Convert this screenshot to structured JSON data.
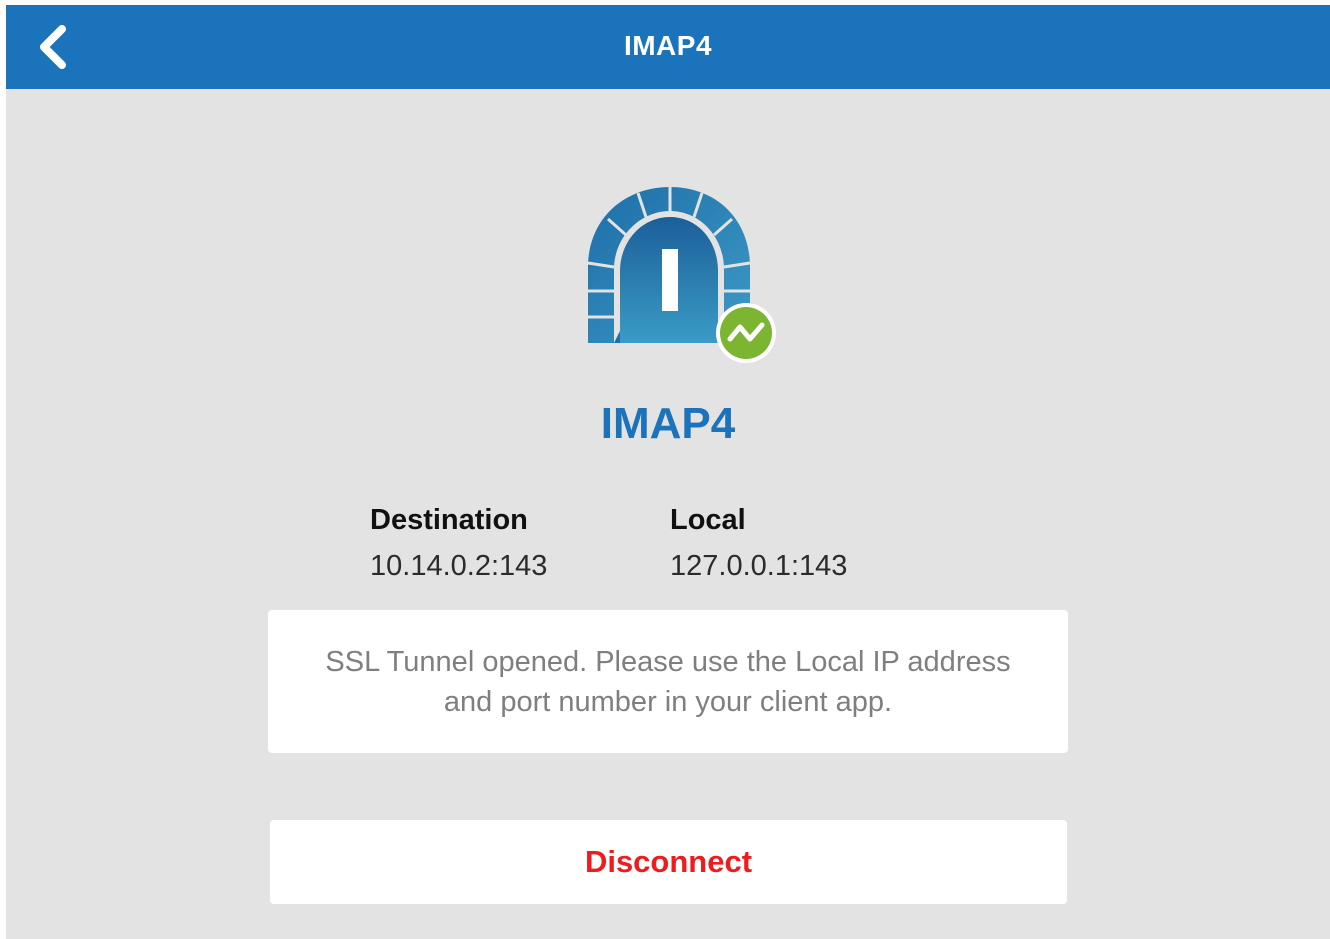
{
  "header": {
    "title": "IMAP4",
    "back_icon": "chevron-left-icon"
  },
  "tunnel": {
    "icon": "tunnel-arch-icon",
    "status_icon": "connected-status-icon",
    "status_color": "#7cb531",
    "name": "IMAP4",
    "name_color": "#1b73bb"
  },
  "destination": {
    "label": "Destination",
    "value": "10.14.0.2:143"
  },
  "local": {
    "label": "Local",
    "value": "127.0.0.1:143"
  },
  "message": {
    "text": "SSL Tunnel opened. Please use the Local IP address and port number in your client app."
  },
  "actions": {
    "disconnect_label": "Disconnect",
    "disconnect_color": "#ee1c1c"
  },
  "colors": {
    "header_bg": "#1b73bb",
    "page_bg": "#e3e3e3"
  }
}
